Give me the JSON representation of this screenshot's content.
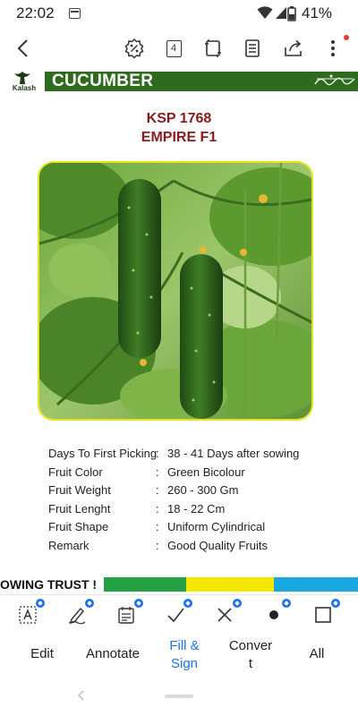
{
  "status_bar": {
    "time": "22:02",
    "battery": "41%"
  },
  "toolbar": {
    "page_count": "4",
    "icons": [
      "back-arrow-icon",
      "zoom-percent-icon",
      "page-count-icon",
      "crop-icon",
      "reading-view-icon",
      "share-icon",
      "more-vertical-icon"
    ]
  },
  "document": {
    "brand": "Kalash",
    "crop_title": "CUCUMBER",
    "variety_code": "KSP 1768",
    "variety_name": "EMPIRE F1",
    "specs": [
      {
        "label": "Days To First Picking",
        "value": "38 - 41 Days after sowing"
      },
      {
        "label": "Fruit Color",
        "value": "Green Bicolour"
      },
      {
        "label": "Fruit Weight",
        "value": "260 - 300 Gm"
      },
      {
        "label": "Fruit Lenght",
        "value": "18 - 22 Cm"
      },
      {
        "label": "Fruit Shape",
        "value": "Uniform Cylindrical"
      },
      {
        "label": "Remark",
        "value": "Good Quality Fruits"
      }
    ],
    "colon": ":",
    "banner_text": "OWING TRUST !"
  },
  "annotation_tools": [
    "text-box-icon",
    "signature-pen-icon",
    "form-fill-icon",
    "checkmark-icon",
    "cross-icon",
    "dot-icon",
    "rectangle-icon"
  ],
  "bottom_tabs": {
    "edit": "Edit",
    "annotate": "Annotate",
    "fill_line1": "Fill &",
    "fill_line2": "Sign",
    "convert_line1": "Conver",
    "convert_line2": "t",
    "all": "All"
  },
  "colors": {
    "header_green": "#2f6b1f",
    "title_red": "#8b1a1a",
    "active_tab": "#1a73e8",
    "banner_green": "#24a142",
    "banner_yellow": "#f3e600",
    "banner_blue": "#1aa7e0"
  }
}
